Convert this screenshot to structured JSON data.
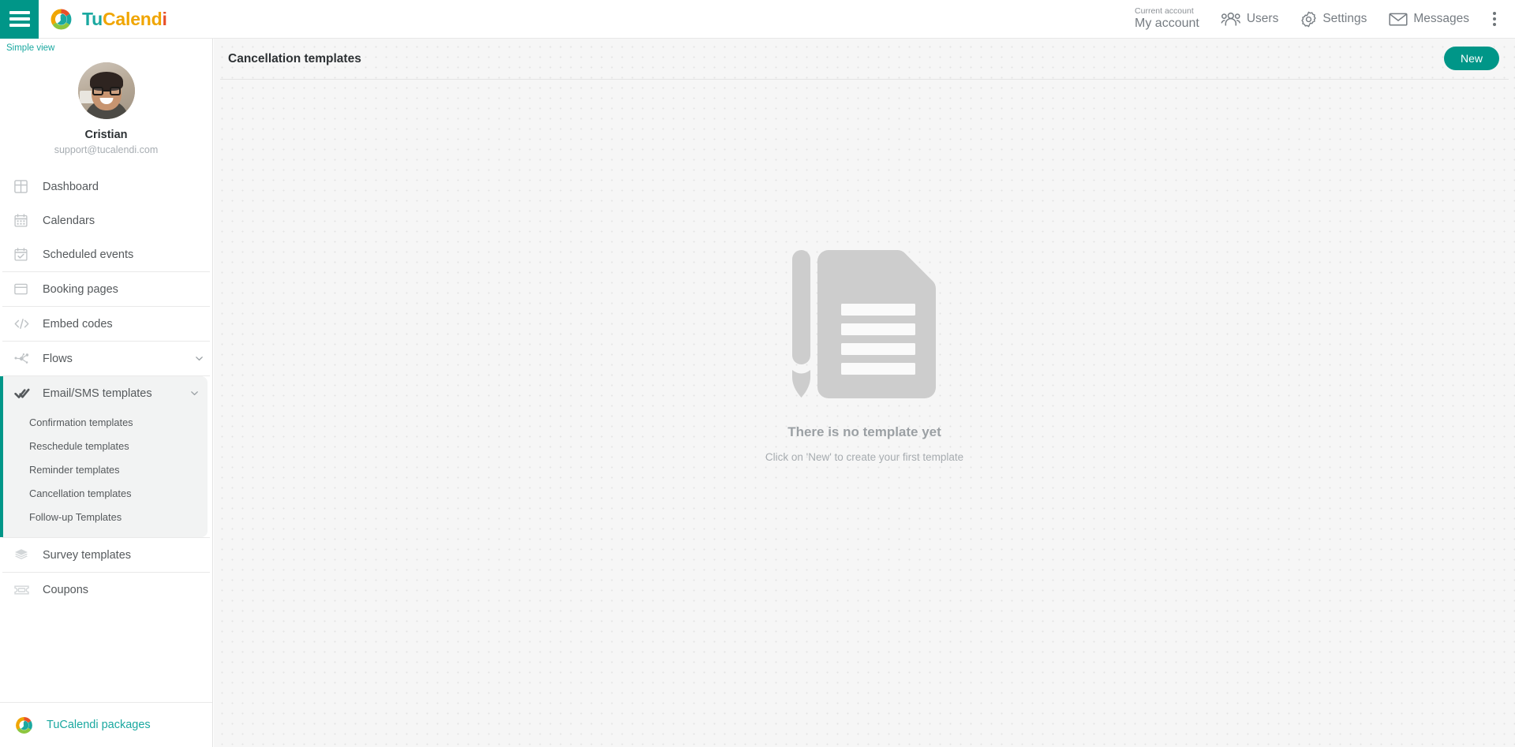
{
  "topbar": {
    "menu_toggle_icon": "hamburger-icon",
    "brand": {
      "part1": "Tu",
      "part2": "Calend",
      "part3": "i",
      "logo_icon": "tucalendi-logo-icon"
    },
    "account": {
      "label": "Current account",
      "value": "My account"
    },
    "nav": [
      {
        "label": "Users",
        "icon": "users-icon"
      },
      {
        "label": "Settings",
        "icon": "gear-icon"
      },
      {
        "label": "Messages",
        "icon": "envelope-icon"
      }
    ],
    "overflow_icon": "kebab-menu-icon"
  },
  "sidebar": {
    "simple_view": "Simple view",
    "profile": {
      "name": "Cristian",
      "email": "support@tucalendi.com",
      "avatar_icon": "user-avatar"
    },
    "items": [
      {
        "label": "Dashboard",
        "icon": "dashboard-grid-icon"
      },
      {
        "label": "Calendars",
        "icon": "calendar-icon"
      },
      {
        "label": "Scheduled events",
        "icon": "calendar-check-icon"
      },
      {
        "label": "Booking pages",
        "icon": "window-icon"
      },
      {
        "label": "Embed codes",
        "icon": "code-brackets-icon"
      },
      {
        "label": "Flows",
        "icon": "flow-nodes-icon",
        "chevron": "chevron-down-icon"
      }
    ],
    "group": {
      "label": "Email/SMS templates",
      "icon": "double-check-icon",
      "chevron": "chevron-down-icon",
      "children": [
        {
          "label": "Confirmation templates"
        },
        {
          "label": "Reschedule templates"
        },
        {
          "label": "Reminder templates"
        },
        {
          "label": "Cancellation templates"
        },
        {
          "label": "Follow-up Templates"
        }
      ]
    },
    "items_after": [
      {
        "label": "Survey templates",
        "icon": "layers-icon"
      },
      {
        "label": "Coupons",
        "icon": "ticket-icon"
      }
    ],
    "packages": {
      "label": "TuCalendi packages",
      "icon": "tucalendi-logo-icon"
    }
  },
  "main": {
    "title": "Cancellation templates",
    "new_button": "New",
    "empty": {
      "illustration_icon": "document-pencil-icon",
      "title": "There is no template yet",
      "subtitle": "Click on 'New' to create your first template"
    }
  },
  "colors": {
    "accent": "#009688",
    "brand_teal": "#1aa8a0",
    "brand_orange": "#f0a500",
    "brand_red": "#e8502a",
    "brand_green": "#8cc63e"
  }
}
